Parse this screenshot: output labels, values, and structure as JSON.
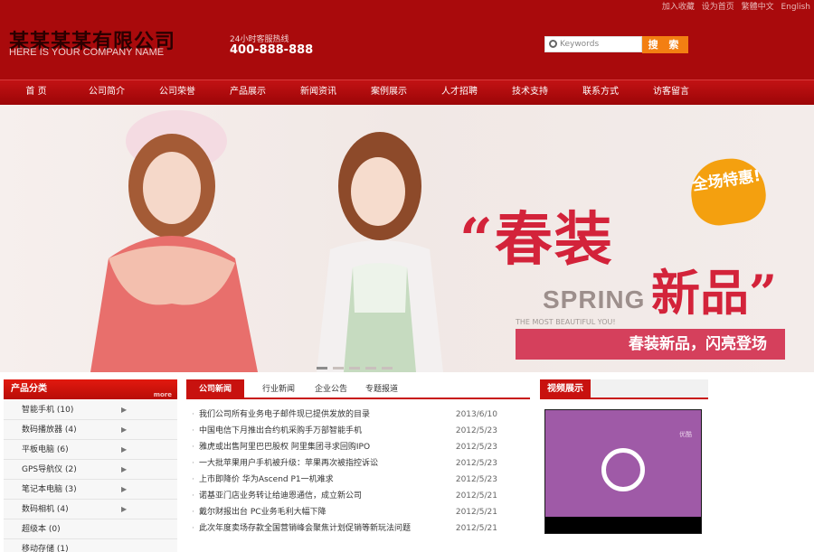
{
  "top_links": [
    "加入收藏",
    "设为首页",
    "繁體中文",
    "English"
  ],
  "logo": {
    "cn": "某某某某有限公司",
    "en": "HERE IS YOUR COMPANY NAME"
  },
  "hotline": {
    "label": "24小时客服热线",
    "number": "400-888-888"
  },
  "search": {
    "placeholder": "Keywords",
    "button": "搜 索"
  },
  "nav": [
    "首 页",
    "公司简介",
    "公司荣誉",
    "产品展示",
    "新闻资讯",
    "案例展示",
    "人才招聘",
    "技术支持",
    "联系方式",
    "访客留言"
  ],
  "banner": {
    "badge": "全场特惠!",
    "headline1": "“春装",
    "headline2": "新品”",
    "spring": "SPRING",
    "spring_sub": "THE MOST BEAUTIFUL YOU!",
    "ribbon": "春装新品，闪亮登场"
  },
  "left": {
    "title": "产品分类",
    "more": "more",
    "items": [
      {
        "label": "智能手机 (10)",
        "arrow": "▶"
      },
      {
        "label": "数码播放器 (4)",
        "arrow": "▶"
      },
      {
        "label": "平板电脑 (6)",
        "arrow": "▶"
      },
      {
        "label": "GPS导航仪 (2)",
        "arrow": "▶"
      },
      {
        "label": "笔记本电脑 (3)",
        "arrow": "▶"
      },
      {
        "label": "数码相机 (4)",
        "arrow": "▶"
      },
      {
        "label": "超级本 (0)",
        "arrow": ""
      },
      {
        "label": "移动存储 (1)",
        "arrow": ""
      }
    ]
  },
  "center": {
    "tabs": [
      "公司新闻",
      "行业新闻",
      "企业公告",
      "专题报道"
    ],
    "news": [
      {
        "title": "我们公司所有业务电子邮件现已提供发放的目录",
        "date": "2013/6/10"
      },
      {
        "title": "中国电信下月推出合约机采购手万部智能手机",
        "date": "2012/5/23"
      },
      {
        "title": "雅虎或出售阿里巴巴股权 阿里集团寻求回购IPO",
        "date": "2012/5/23"
      },
      {
        "title": "一大批苹果用户手机被升级：苹果再次被指控诉讼",
        "date": "2012/5/23"
      },
      {
        "title": "上市即降价 华为Ascend P1一机难求",
        "date": "2012/5/23"
      },
      {
        "title": "诺基亚门店业务转让给迪恩通信，成立新公司",
        "date": "2012/5/21"
      },
      {
        "title": "戴尔财报出台 PC业务毛利大幅下降",
        "date": "2012/5/21"
      },
      {
        "title": "此次年度卖场存款全国营销峰会聚焦计划促销等新玩法问题",
        "date": "2012/5/21"
      }
    ]
  },
  "right": {
    "title": "视频展示",
    "video_mark": "优酷"
  },
  "colors": {
    "header": "#a90a0c",
    "accent": "#c8120f",
    "button": "#f37f12",
    "banner_text": "#d3233a"
  }
}
